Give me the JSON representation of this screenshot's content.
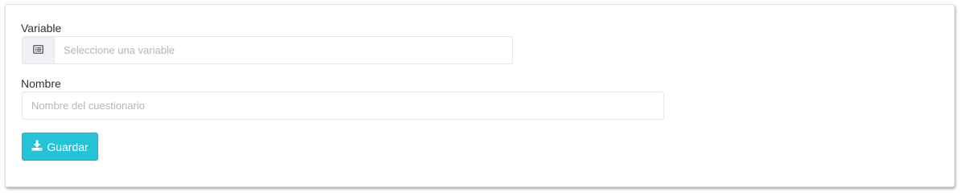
{
  "form": {
    "variable_label": "Variable",
    "variable_placeholder": "Seleccione una variable",
    "variable_addon_icon": "list-icon",
    "name_label": "Nombre",
    "name_placeholder": "Nombre del cuestionario",
    "save_label": "Guardar",
    "save_icon": "download-icon",
    "save_color": "#25c2d8"
  }
}
